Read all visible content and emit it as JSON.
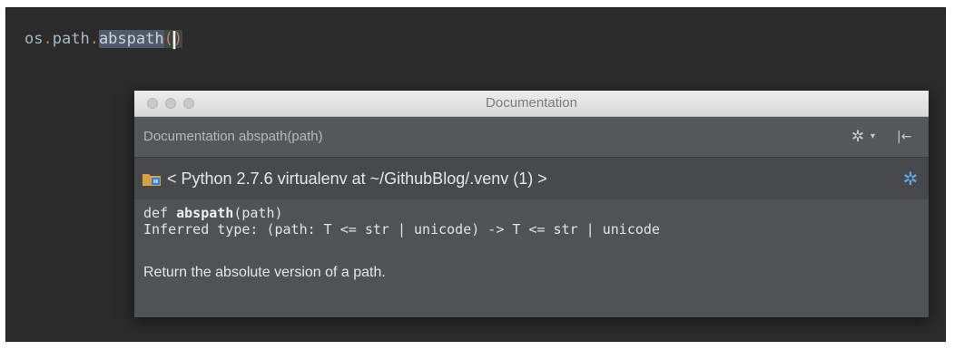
{
  "editor": {
    "code_module": "os",
    "code_dot1": ".",
    "code_attr": "path",
    "code_dot2": ".",
    "code_func": "abspath",
    "code_parens": "()"
  },
  "popup": {
    "title": "Documentation",
    "header_text": "Documentation abspath(path)",
    "context_text": "< Python 2.7.6 virtualenv at ~/GithubBlog/.venv (1) >",
    "signature_prefix": "def ",
    "signature_name": "abspath",
    "signature_args": "(path)",
    "inferred_type": "Inferred type: (path: T <= str | unicode) -> T <= str | unicode",
    "description": "Return the absolute version of a path."
  },
  "icons": {
    "settings": "gear-icon",
    "settings_dropdown": "chevron-down-icon",
    "pin": "pin-icon",
    "folder": "folder-icon",
    "context_settings": "gear-icon",
    "text_cursor": "i-beam-cursor-icon"
  },
  "colors": {
    "editor_bg": "#2b2b2b",
    "keyword_dot": "#cc7832",
    "selection": "#4d5a6e",
    "paren_match": "#e06c75",
    "accent_gear": "#5da8e8"
  }
}
